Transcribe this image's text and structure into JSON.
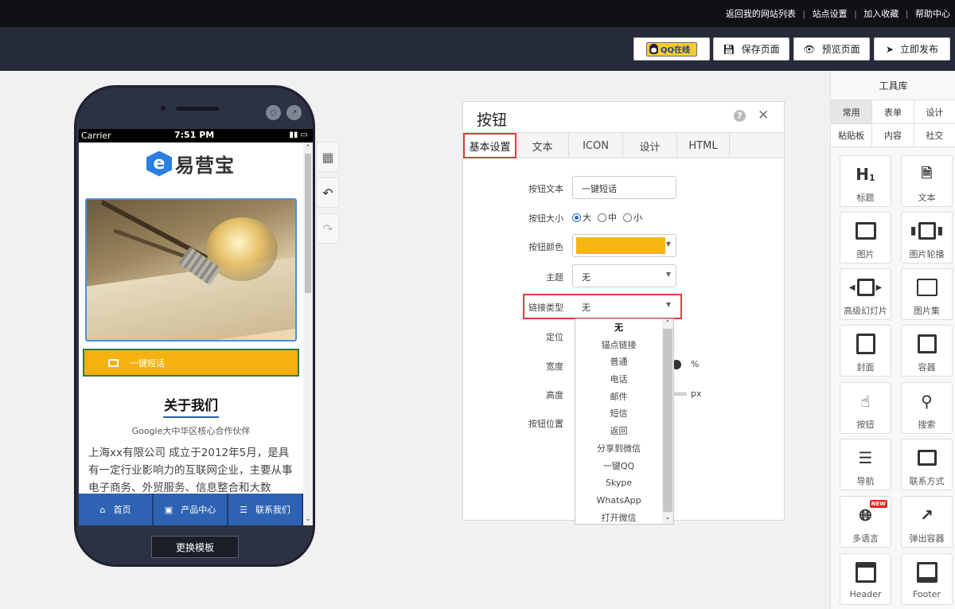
{
  "topbar": {
    "links": [
      "返回我的网站列表",
      "站点设置",
      "加入收藏",
      "帮助中心"
    ]
  },
  "toolbar": {
    "qq_label": "QQ在线",
    "save_label": "保存页面",
    "preview_label": "预览页面",
    "publish_label": "立即发布"
  },
  "phone": {
    "carrier": "Carrier",
    "time": "7:51 PM",
    "logo_text": "易营宝",
    "cta_label": "一键短话",
    "about_title": "关于我们",
    "about_subtitle": "Google大中华区核心合作伙伴",
    "about_body": "上海xx有限公司 成立于2012年5月，是具有一定行业影响力的互联网企业，主要从事电子商务、外贸服务、信息整合和大数",
    "nav": [
      "首页",
      "产品中心",
      "联系我们"
    ],
    "change_template_label": "更换模板"
  },
  "panel": {
    "title": "按钮",
    "tabs": [
      "基本设置",
      "文本",
      "ICON",
      "设计",
      "HTML"
    ],
    "active_tab": "基本设置",
    "fields": {
      "button_text_label": "按钮文本",
      "button_text_value": "一键短话",
      "size_label": "按钮大小",
      "size_options": [
        "大",
        "中",
        "小"
      ],
      "size_selected": "大",
      "color_label": "按钮颜色",
      "color_value": "#f7b513",
      "theme_label": "主题",
      "theme_value": "无",
      "link_type_label": "链接类型",
      "link_type_value": "无",
      "position_label": "定位",
      "width_label": "宽度",
      "width_unit": "%",
      "height_label": "高度",
      "height_unit": "px",
      "btn_position_label": "按钮位置"
    },
    "link_type_options": [
      "无",
      "锚点链接",
      "普通",
      "电话",
      "邮件",
      "短信",
      "返回",
      "分享到微信",
      "一键QQ",
      "Skype",
      "WhatsApp",
      "打开微信"
    ]
  },
  "toolbox": {
    "title": "工具库",
    "tabs_row1": [
      "常用",
      "表单",
      "设计"
    ],
    "tabs_row2": [
      "粘贴板",
      "内容",
      "社交"
    ],
    "active_tab": "常用",
    "tiles": [
      {
        "label": "标题",
        "icon": "heading-icon"
      },
      {
        "label": "文本",
        "icon": "text-file-icon"
      },
      {
        "label": "图片",
        "icon": "image-icon"
      },
      {
        "label": "图片轮播",
        "icon": "carousel-icon"
      },
      {
        "label": "高级幻灯片",
        "icon": "slideshow-icon"
      },
      {
        "label": "图片集",
        "icon": "gallery-icon"
      },
      {
        "label": "封面",
        "icon": "cover-icon"
      },
      {
        "label": "容器",
        "icon": "container-icon"
      },
      {
        "label": "按钮",
        "icon": "pointer-icon"
      },
      {
        "label": "搜索",
        "icon": "search-icon"
      },
      {
        "label": "导航",
        "icon": "nav-list-icon"
      },
      {
        "label": "联系方式",
        "icon": "contact-card-icon"
      },
      {
        "label": "多语言",
        "icon": "globe-icon",
        "badge": "NEW"
      },
      {
        "label": "弹出容器",
        "icon": "popup-icon"
      },
      {
        "label": "Header",
        "icon": "header-icon"
      },
      {
        "label": "Footer",
        "icon": "footer-icon"
      }
    ]
  }
}
